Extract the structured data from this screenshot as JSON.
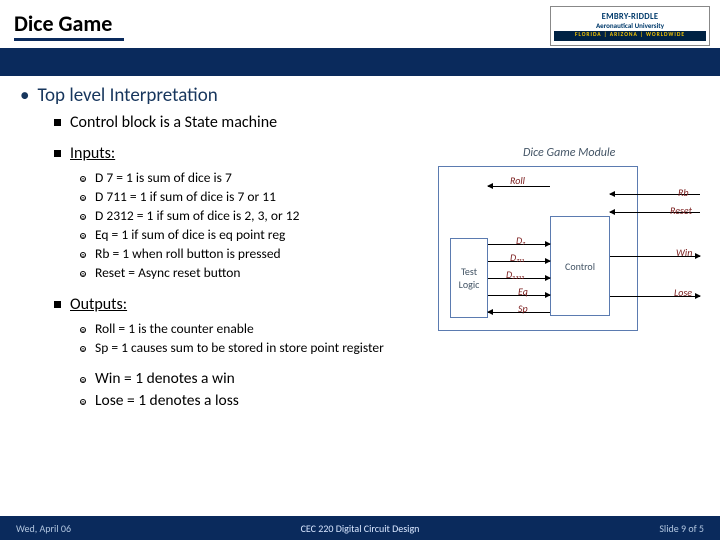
{
  "header": {
    "title": "Dice Game",
    "logo_univ": "EMBRY-RIDDLE",
    "logo_sub": "Aeronautical University",
    "logo_bar": "FLORIDA | ARIZONA | WORLDWIDE"
  },
  "main": {
    "top_bullet": "Top level Interpretation",
    "sub1": "Control block is a State machine",
    "inputs_label": "Inputs:",
    "inputs": [
      "D 7 = 1 is sum of dice is 7",
      "D 711 = 1 if sum of dice is 7 or 11",
      "D 2312 = 1 if sum of dice is 2, 3, or 12",
      "Eq = 1 if sum of dice is eq point reg",
      "Rb = 1 when roll button is pressed",
      "Reset = Async reset button"
    ],
    "outputs_label": "Outputs:",
    "outputs_small": [
      "Roll = 1 is the counter enable",
      "Sp = 1 causes sum to be stored in store point register"
    ],
    "outputs_big": [
      "Win = 1 denotes a win",
      "Lose = 1 denotes a loss"
    ]
  },
  "diagram": {
    "caption": "Dice Game Module",
    "test_logic": "Test Logic",
    "control": "Control",
    "signals": {
      "roll": "Roll",
      "rb": "Rb",
      "reset": "Reset",
      "d7": "D₇",
      "d711": "D₇₁₁",
      "d2312": "D₂₃₁₂",
      "eq": "Eq",
      "sp": "Sp",
      "win": "Win",
      "lose": "Lose"
    }
  },
  "footer": {
    "left": "Wed, April 06",
    "center": "CEC 220 Digital Circuit Design",
    "right": "Slide 9 of 5"
  }
}
